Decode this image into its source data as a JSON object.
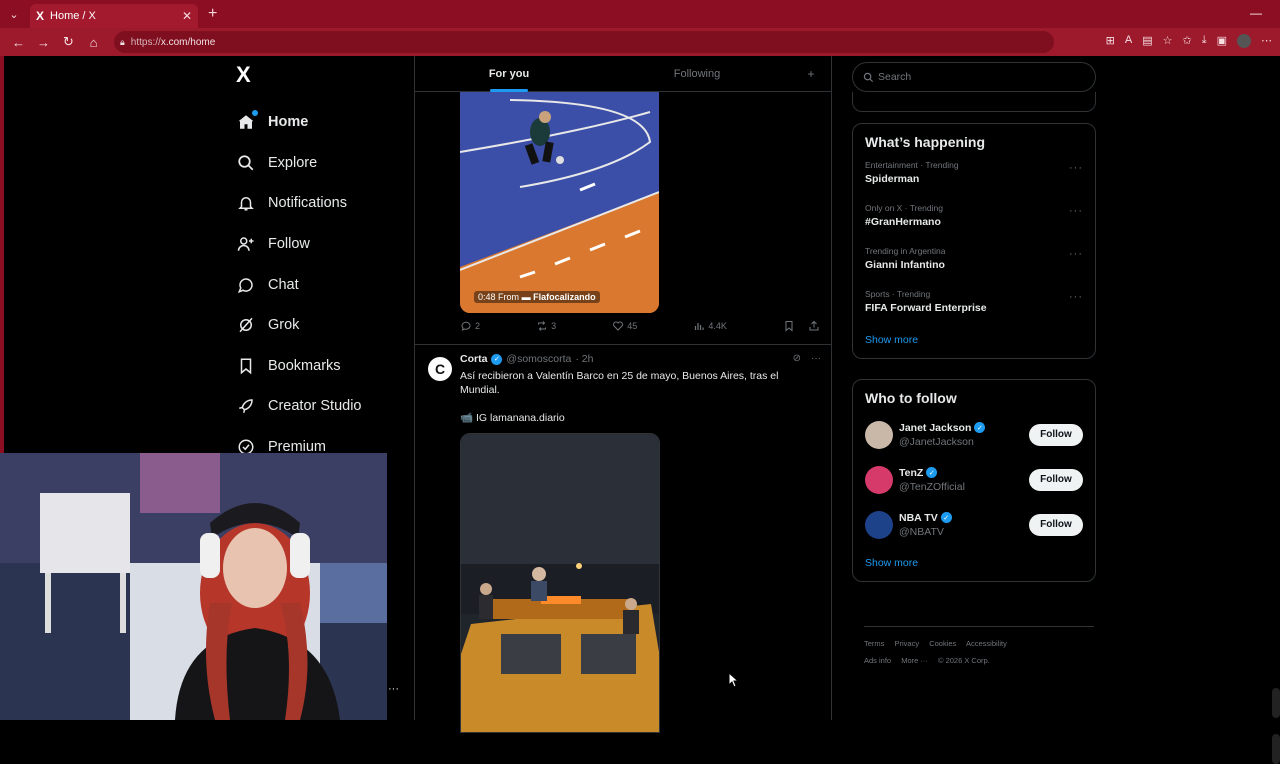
{
  "browser": {
    "tab_title": "Home / X",
    "tab_logo": "X",
    "url_prefix": "https://",
    "url_host": "x.com/home",
    "new_tab": "+",
    "icons": [
      "back-icon",
      "forward-icon",
      "refresh-icon",
      "home-icon",
      "lock-icon"
    ]
  },
  "nav": {
    "logo": "X",
    "items": [
      {
        "label": "Home",
        "icon": "home-icon",
        "active": true
      },
      {
        "label": "Explore",
        "icon": "search-icon"
      },
      {
        "label": "Notifications",
        "icon": "bell-icon"
      },
      {
        "label": "Follow",
        "icon": "add-user-icon"
      },
      {
        "label": "Chat",
        "icon": "chat-icon"
      },
      {
        "label": "Grok",
        "icon": "grok-icon"
      },
      {
        "label": "Bookmarks",
        "icon": "bookmark-icon"
      },
      {
        "label": "Creator Studio",
        "icon": "rocket-icon"
      },
      {
        "label": "Premium",
        "icon": "premium-icon"
      }
    ]
  },
  "feed": {
    "tabs": [
      "For you",
      "Following"
    ],
    "plus": "+",
    "tweet1": {
      "media_time": "0:48",
      "media_from": "From",
      "media_source": "Flafocalizando",
      "replies": "2",
      "reposts": "3",
      "likes": "45",
      "views": "4.4K"
    },
    "tweet2": {
      "avatar_letter": "C",
      "name": "Corta",
      "handle": "@somoscorta",
      "time": "· 2h",
      "text": "Así recibieron a Valentín Barco en 25 de mayo, Buenos Aires, tras el Mundial.",
      "source": "📹 IG lamanana.diario"
    }
  },
  "right": {
    "search_placeholder": "Search",
    "happening_title": "What’s happening",
    "trends": [
      {
        "context": "Entertainment · Trending",
        "title": "Spiderman"
      },
      {
        "context": "Only on X · Trending",
        "title": "#GranHermano"
      },
      {
        "context": "Trending in Argentina",
        "title": "Gianni Infantino"
      },
      {
        "context": "Sports · Trending",
        "title": "FIFA Forward Enterprise"
      }
    ],
    "show_more": "Show more",
    "who_title": "Who to follow",
    "who": [
      {
        "name": "Janet Jackson",
        "handle": "@JanetJackson",
        "avatar_color": "#c9b8a8"
      },
      {
        "name": "TenZ",
        "handle": "@TenZOfficial",
        "avatar_color": "#d63a6a"
      },
      {
        "name": "NBA TV",
        "handle": "@NBATV",
        "avatar_color": "#1d428a"
      }
    ],
    "follow_label": "Follow",
    "footer": [
      "Terms",
      "Privacy",
      "Cookies",
      "Accessibility",
      "Ads info",
      "More ···",
      "© 2026 X Corp."
    ]
  },
  "colors": {
    "browser_red": "#8b0e22",
    "accent_blue": "#1d9bf0",
    "show_more_green": "#1d9bf0"
  }
}
